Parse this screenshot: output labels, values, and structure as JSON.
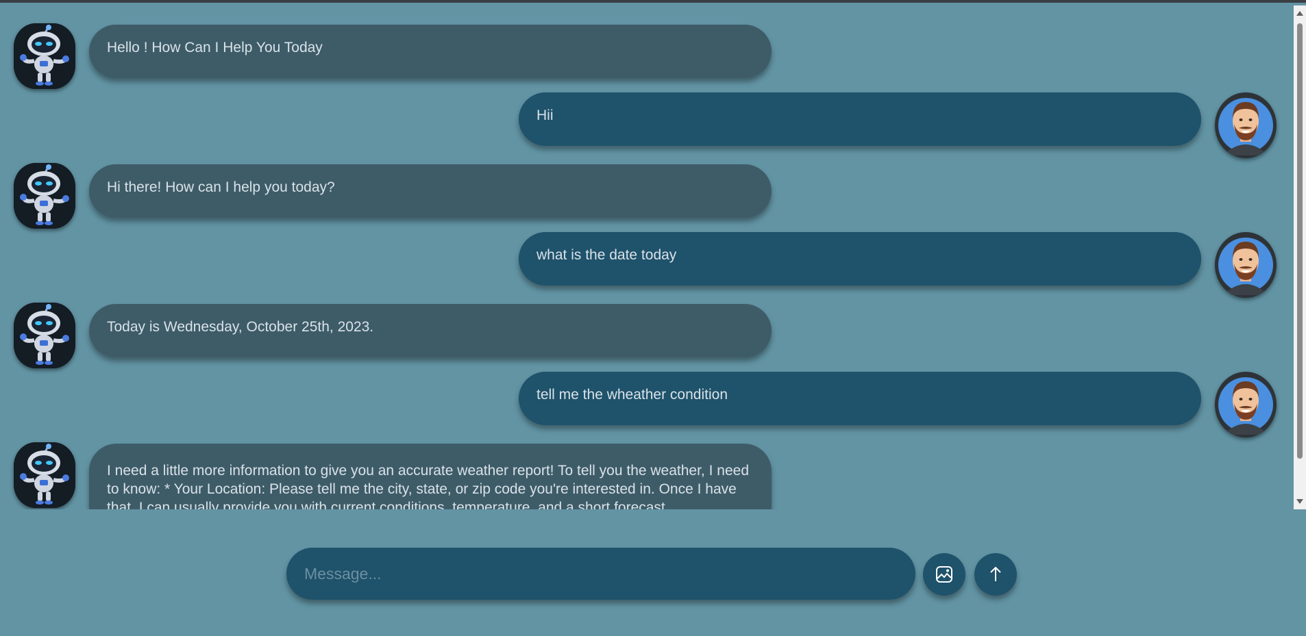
{
  "messages": [
    {
      "role": "bot",
      "text": "Hello ! How Can I Help You Today"
    },
    {
      "role": "user",
      "text": "Hii"
    },
    {
      "role": "bot",
      "text": "Hi there! How can I help you today?"
    },
    {
      "role": "user",
      "text": "what is the date today"
    },
    {
      "role": "bot",
      "text": "Today is Wednesday, October 25th, 2023."
    },
    {
      "role": "user",
      "text": "tell me the wheather condition"
    },
    {
      "role": "bot",
      "text": "I need a little more information to give you an accurate weather report! To tell you the weather, I need to know: * Your Location: Please tell me the city, state, or zip code you're interested in. Once I have that, I can usually provide you with current conditions, temperature, and a short forecast."
    }
  ],
  "composer": {
    "placeholder": "Message...",
    "value": ""
  },
  "icons": {
    "image_button": "image-icon",
    "send_button": "arrow-up-icon",
    "bot_avatar": "robot-avatar",
    "user_avatar": "user-avatar"
  },
  "colors": {
    "background": "#6294a4",
    "bot_bubble": "#3e5c68",
    "user_bubble": "#1f526b",
    "text": "#d9e2e8"
  }
}
